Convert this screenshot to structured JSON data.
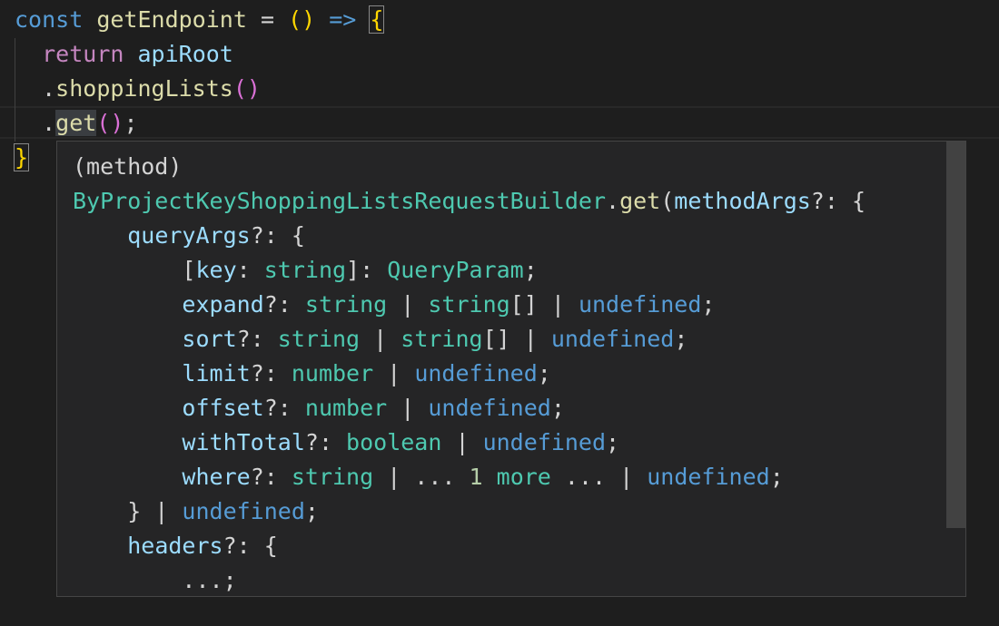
{
  "editor": {
    "line1": {
      "kw_const": "const",
      "name": "getEndpoint",
      "eq": " = ",
      "parens": "()",
      "arrow": " => ",
      "brace": "{"
    },
    "line2": {
      "kw_return": "return",
      "api": "apiRoot"
    },
    "line3": {
      "dot": ".",
      "method": "shoppingLists",
      "parens": "()"
    },
    "line4": {
      "dot": ".",
      "method": "get",
      "parens": "()",
      "semi": ";"
    },
    "line5": {
      "brace": "}"
    }
  },
  "hover": {
    "lines": [
      "(method)",
      "ByProjectKeyShoppingListsRequestBuilder.get(methodArgs?: {",
      "    queryArgs?: {",
      "        [key: string]: QueryParam;",
      "        expand?: string | string[] | undefined;",
      "        sort?: string | string[] | undefined;",
      "        limit?: number | undefined;",
      "        offset?: number | undefined;",
      "        withTotal?: boolean | undefined;",
      "        where?: string | ... 1 more ... | undefined;",
      "    } | undefined;",
      "    headers?: {",
      "        ...;"
    ]
  }
}
